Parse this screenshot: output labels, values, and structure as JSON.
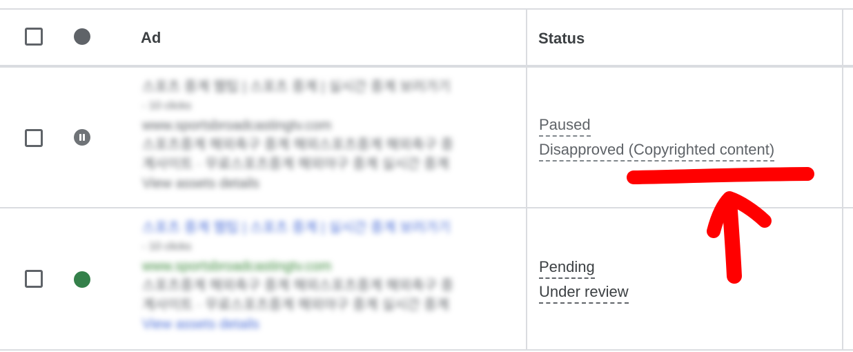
{
  "table": {
    "headers": {
      "ad": "Ad",
      "status": "Status"
    },
    "rows": [
      {
        "ad_lines": [
          "스포츠 중계 웹팁 | 스포츠 중계 | 실시간 중계 보러가기",
          "- 10 clicks",
          "www.sportsbroadcastingtv.com",
          "스포츠중계 해외축구 중계 해외스포츠중계 해외축구 중",
          "계사이트 · 무료스포츠중계 해외야구 중계 실시간 중계",
          "View assets details"
        ],
        "status_primary": "Paused",
        "status_secondary": "Disapproved (Copyrighted content)",
        "state": "paused",
        "state_icon": "pause-icon"
      },
      {
        "ad_lines": [
          "스포츠 중계 웹팁 | 스포츠 중계 | 실시간 중계 보러가기",
          "- 10 clicks",
          "www.sportsbroadcastingtv.com",
          "스포츠중계 해외축구 중계 해외스포츠중계 해외축구 중",
          "계사이트 · 무료스포츠중계 해외야구 중계 실시간 중계",
          "View assets details"
        ],
        "status_primary": "Pending",
        "status_secondary": "Under review",
        "state": "enabled",
        "state_icon": "enabled-dot-icon"
      }
    ]
  },
  "colors": {
    "annotation": "#ff0000",
    "enabled": "#34804a",
    "paused": "#6f7377",
    "link_blue": "#4c6fd8",
    "url_green": "#3d8b3d"
  }
}
